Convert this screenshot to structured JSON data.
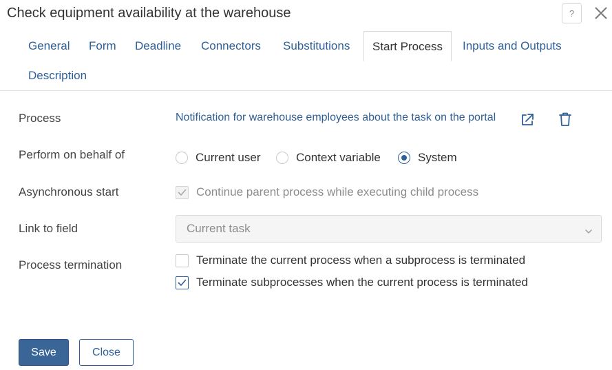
{
  "dialog": {
    "title": "Check equipment availability at the warehouse",
    "help_label": "?"
  },
  "tabs": [
    {
      "label": "General",
      "active": false
    },
    {
      "label": "Form",
      "active": false
    },
    {
      "label": "Deadline",
      "active": false
    },
    {
      "label": "Connectors",
      "active": false
    },
    {
      "label": "Substitutions",
      "active": false
    },
    {
      "label": "Start Process",
      "active": true
    },
    {
      "label": "Inputs and Outputs",
      "active": false
    },
    {
      "label": "Description",
      "active": false
    }
  ],
  "form": {
    "process": {
      "label": "Process",
      "value": "Notification for warehouse employees about the task on the portal"
    },
    "perform_on_behalf": {
      "label": "Perform on behalf of",
      "options": [
        "Current user",
        "Context variable",
        "System"
      ],
      "selected": "System"
    },
    "async_start": {
      "label": "Asynchronous start",
      "checkbox_label": "Continue parent process while executing child process",
      "checked": true,
      "disabled": true
    },
    "link_to_field": {
      "label": "Link to field",
      "value": "Current task"
    },
    "termination": {
      "label": "Process termination",
      "options": [
        {
          "label": "Terminate the current process when a subprocess is terminated",
          "checked": false
        },
        {
          "label": "Terminate subprocesses when the current process is terminated",
          "checked": true
        }
      ]
    }
  },
  "footer": {
    "save_label": "Save",
    "close_label": "Close"
  },
  "colors": {
    "accent": "#2e5f97",
    "primary_button": "#3a6597",
    "text": "#333333",
    "disabled_text": "#8c8c8c"
  }
}
